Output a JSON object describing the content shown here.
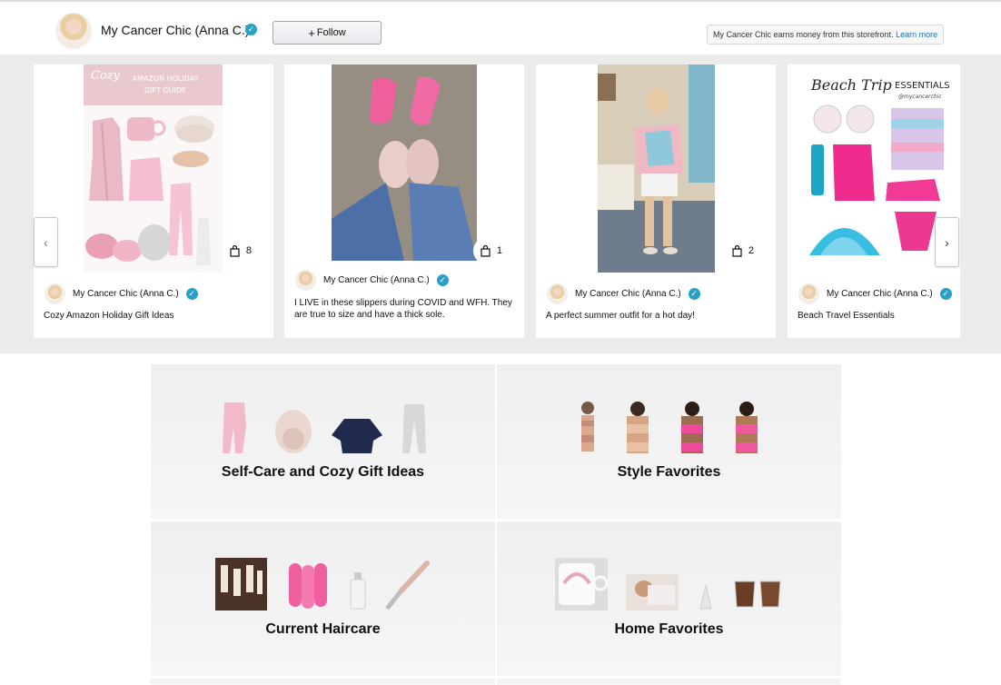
{
  "header": {
    "store_name": "My Cancer Chic (Anna C.)",
    "follow_label": "Follow",
    "earns_text": "My Cancer Chic earns money from this storefront.",
    "learn_more": "Learn more"
  },
  "posts": [
    {
      "author": "My Cancer Chic (Anna C.)",
      "product_count": "8",
      "caption": "Cozy Amazon Holiday Gift Ideas"
    },
    {
      "author": "My Cancer Chic (Anna C.)",
      "product_count": "1",
      "caption": "I LIVE in these slippers during COVID and WFH. They are true to size and have a thick sole."
    },
    {
      "author": "My Cancer Chic (Anna C.)",
      "product_count": "2",
      "caption": "A perfect summer outfit for a hot day!"
    },
    {
      "author": "My Cancer Chic (Anna C.)",
      "caption": "Beach Travel Essentials"
    }
  ],
  "post_images": {
    "gift_guide_title": "Cozy",
    "gift_guide_subtitle": "AMAZON HOLIDAY\nGIFT GUIDE",
    "beach_title": "Beach Trip",
    "beach_subtitle": "ESSENTIALS",
    "beach_handle": "@mycancerchic"
  },
  "categories": [
    {
      "title": "Self-Care and Cozy Gift Ideas"
    },
    {
      "title": "Style Favorites"
    },
    {
      "title": "Current Haircare"
    },
    {
      "title": "Home Favorites"
    }
  ],
  "icons": {
    "verified": "verified-badge-icon",
    "bag": "shopping-bag-icon",
    "prev": "chevron-left-icon",
    "next": "chevron-right-icon"
  },
  "colors": {
    "verified": "#2aa0c7",
    "link": "#1a73a8",
    "carousel_bg": "#ebebea"
  }
}
